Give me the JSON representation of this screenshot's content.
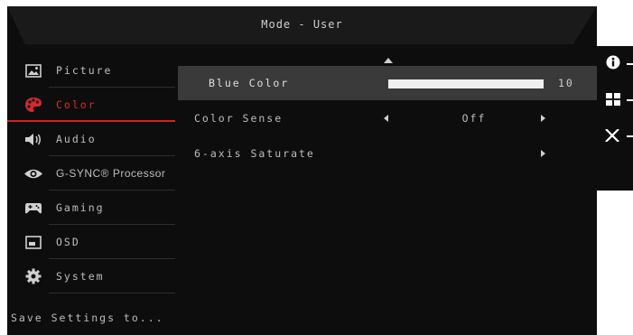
{
  "header": {
    "title": "Mode - User"
  },
  "sidebar": {
    "items": [
      {
        "label": "Picture",
        "icon": "picture-icon",
        "active": false
      },
      {
        "label": "Color",
        "icon": "color-palette-icon",
        "active": true
      },
      {
        "label": "Audio",
        "icon": "speaker-icon",
        "active": false
      },
      {
        "label": "G-SYNC® Processor",
        "icon": "gsync-icon",
        "active": false
      },
      {
        "label": "Gaming",
        "icon": "gamepad-icon",
        "active": false
      },
      {
        "label": "OSD",
        "icon": "osd-icon",
        "active": false
      },
      {
        "label": "System",
        "icon": "gear-icon",
        "active": false
      }
    ],
    "save_label": "Save Settings to..."
  },
  "content": {
    "rows": [
      {
        "label": "Blue Color",
        "type": "slider",
        "value": "10",
        "fill_fraction": 1.0
      },
      {
        "label": "Color Sense",
        "type": "select",
        "value": "Off"
      },
      {
        "label": "6-axis Saturate",
        "type": "submenu",
        "value": ""
      }
    ]
  },
  "hotkeys": [
    {
      "icon": "info-icon"
    },
    {
      "icon": "grid-menu-icon"
    },
    {
      "icon": "close-icon"
    }
  ],
  "colors": {
    "accent": "#d8292f",
    "panel": "#0d0d0d",
    "highlight": "#3a3a3a"
  }
}
